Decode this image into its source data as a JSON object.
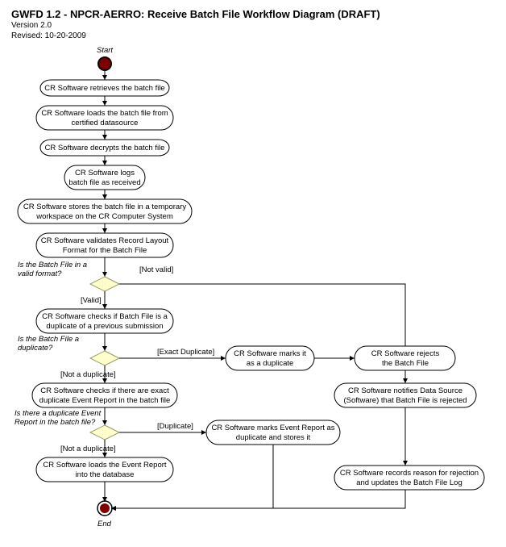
{
  "header": {
    "title": "GWFD 1.2 - NPCR-AERRO:  Receive Batch File Workflow Diagram (DRAFT)",
    "version": "Version 2.0",
    "revised": "Revised: 10-20-2009"
  },
  "labels": {
    "start": "Start",
    "end": "End",
    "q_valid_format_1": "Is the Batch File in a",
    "q_valid_format_2": "valid format?",
    "edge_valid": "[Valid]",
    "edge_not_valid": "[Not valid]",
    "q_duplicate_1": "Is the Batch File a",
    "q_duplicate_2": "duplicate?",
    "edge_exact_dup": "[Exact Duplicate]",
    "edge_not_dup": "[Not a duplicate]",
    "q_dup_event_1": "Is there a duplicate Event",
    "q_dup_event_2": "Report in the batch file?",
    "edge_duplicate": "[Duplicate]",
    "edge_not_dup2": "[Not a duplicate]"
  },
  "nodes": {
    "retrieve": "CR Software retrieves the batch file",
    "load_1": "CR Software loads the batch file from",
    "load_2": "certified datasource",
    "decrypt": "CR Software decrypts the batch file",
    "log_1": "CR Software logs",
    "log_2": "batch file as received",
    "store_1": "CR Software stores the batch file in a temporary",
    "store_2": "workspace on the CR Computer System",
    "validate_1": "CR Software validates Record Layout",
    "validate_2": "Format for the Batch File",
    "check_dup_1": "CR Software checks if Batch File is a",
    "check_dup_2": "duplicate of a previous submission",
    "mark_dup_1": "CR Software marks it",
    "mark_dup_2": "as a duplicate",
    "reject_1": "CR Software rejects",
    "reject_2": "the Batch File",
    "notify_1": "CR Software notifies Data Source",
    "notify_2": "(Software) that Batch File is rejected",
    "check_evt_dup_1": "CR Software checks if there are exact",
    "check_evt_dup_2": "duplicate Event Report in the batch file",
    "mark_evt_1": "CR Software marks Event Report as",
    "mark_evt_2": "duplicate and stores it",
    "load_evt_1": "CR Software loads the Event Report",
    "load_evt_2": "into the database",
    "record_1": "CR Software records reason for rejection",
    "record_2": "and updates the Batch File Log"
  }
}
